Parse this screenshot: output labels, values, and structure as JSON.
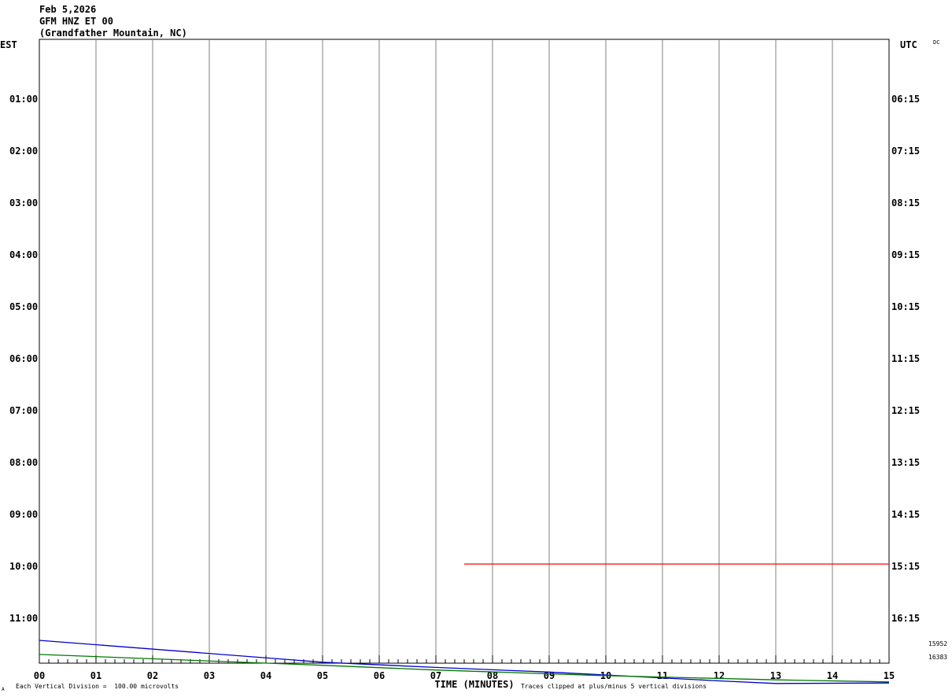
{
  "header": {
    "date": "Feb 5,2026",
    "station": "GFM HNZ ET 00",
    "location": "(Grandfather Mountain, NC)"
  },
  "left_axis_label": "EST",
  "right_axis_label": "UTC",
  "corner_label": "DC",
  "footer": {
    "scale_note": "Each Vertical Division =  100.00 microvolts",
    "x_axis_title": "TIME (MINUTES)",
    "clip_note": "Traces clipped at plus/minus 5 vertical divisions",
    "corner_mark": "A"
  },
  "right_values": [
    "15952",
    "16383"
  ],
  "chart_data": {
    "type": "line",
    "title": "",
    "xlabel": "TIME (MINUTES)",
    "x_ticks": [
      "00",
      "01",
      "02",
      "03",
      "04",
      "05",
      "06",
      "07",
      "08",
      "09",
      "10",
      "11",
      "12",
      "13",
      "14",
      "15"
    ],
    "xlim": [
      0,
      15
    ],
    "rows_est": [
      "",
      "01:00",
      "02:00",
      "03:00",
      "04:00",
      "05:00",
      "06:00",
      "07:00",
      "08:00",
      "09:00",
      "10:00",
      "11:00"
    ],
    "rows_utc": [
      "",
      "06:15",
      "07:15",
      "08:15",
      "09:15",
      "10:15",
      "11:15",
      "12:15",
      "13:15",
      "14:15",
      "15:15",
      "16:15"
    ],
    "grid": true,
    "series": [
      {
        "color": "#ff0000",
        "row": "10:00",
        "x_start": 7.5,
        "x_end": 15,
        "level_rows": 10
      },
      {
        "color": "#0000cc",
        "row": "12:00",
        "points": [
          [
            0,
            11.44
          ],
          [
            5,
            11.86
          ],
          [
            7,
            11.96
          ],
          [
            9,
            12.05
          ],
          [
            12,
            12.22
          ],
          [
            13,
            12.27
          ],
          [
            15,
            12.26
          ]
        ]
      },
      {
        "color": "#007700",
        "row": "12:00",
        "points": [
          [
            0,
            11.71
          ],
          [
            5,
            11.92
          ],
          [
            7,
            12.01
          ],
          [
            10,
            12.12
          ],
          [
            13,
            12.2
          ],
          [
            15,
            12.24
          ]
        ]
      }
    ],
    "colors": {
      "grid": "#808080",
      "red_trace": "#ff0000",
      "blue_trace": "#0000cc",
      "green_trace": "#007700"
    }
  }
}
